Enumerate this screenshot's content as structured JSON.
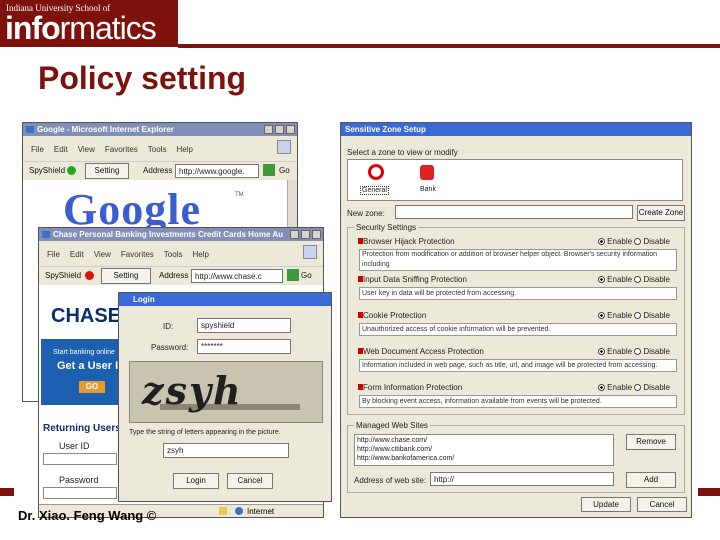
{
  "header": {
    "logo_line1": "Indiana University School of",
    "logo_info": "info",
    "logo_rest": "rmatics"
  },
  "slide": {
    "title": "Policy setting",
    "footer": "Dr. Xiao. Feng Wang ©"
  },
  "ie_google": {
    "title": "Google - Microsoft Internet Explorer",
    "menu": [
      "File",
      "Edit",
      "View",
      "Favorites",
      "Tools",
      "Help"
    ],
    "spyshield_label": "SpyShield",
    "setting_button": "Setting",
    "address_label": "Address",
    "address_value": "http://www.google.",
    "go_label": "Go",
    "logo_text": "Google",
    "tm": "TM",
    "indicator_color": "#22aa22"
  },
  "ie_chase": {
    "title": "Chase Personal Banking Investments Credit Cards Home Au",
    "menu": [
      "File",
      "Edit",
      "View",
      "Favorites",
      "Tools",
      "Help"
    ],
    "spyshield_label": "SpyShield",
    "setting_button": "Setting",
    "address_label": "Address",
    "address_value": "http://www.chase.c",
    "go_label": "Go",
    "chase_logo": "CHASE",
    "banner_line1": "Start banking online",
    "banner_line2": "Get a User ID",
    "banner_go": "GO",
    "returning_users": "Returning Users: Log",
    "user_id_label": "User ID",
    "password_label": "Password",
    "status_internet": "Internet",
    "indicator_color": "#dd1111"
  },
  "login": {
    "title": "Login",
    "id_label": "ID:",
    "id_value": "spyshield",
    "password_label": "Password:",
    "password_value": "*******",
    "captcha_text": "zsyh",
    "instruction": "Type the string of letters appearing in the picture.",
    "captcha_input": "zsyh",
    "login_button": "Login",
    "cancel_button": "Cancel"
  },
  "zone_setup": {
    "title": "Sensitive Zone Setup",
    "select_label": "Select a zone to view or modify",
    "zones": [
      {
        "label": "General",
        "icon": "no-entry-icon"
      },
      {
        "label": "Bank",
        "icon": "money-icon"
      }
    ],
    "new_zone_label": "New zone:",
    "create_zone_button": "Create Zone",
    "security_settings_label": "Security Settings",
    "settings": [
      {
        "label": "Browser Hijack Protection",
        "desc": "Protection from modification or addition of browser helper object. Browser's security information including",
        "enable": "Enable",
        "disable": "Disable"
      },
      {
        "label": "Input Data Sniffing Protection",
        "desc": "User key in data will be protected from accessing.",
        "enable": "Enable",
        "disable": "Disable"
      },
      {
        "label": "Cookie Protection",
        "desc": "Unauthorized access of cookie information will be prevented.",
        "enable": "Enable",
        "disable": "Disable"
      },
      {
        "label": "Web Document Access Protection",
        "desc": "Information included in web page, such as title, url, and image will be protected from accessing.",
        "enable": "Enable",
        "disable": "Disable"
      },
      {
        "label": "Form Information Protection",
        "desc": "By blocking event access, information available from events will be protected.",
        "enable": "Enable",
        "disable": "Disable"
      }
    ],
    "managed_sites_label": "Managed Web Sites",
    "sites": [
      "http://www.chase.com/",
      "http://www.citibank.com/",
      "http://www.bankofamerica.com/"
    ],
    "remove_button": "Remove",
    "address_label": "Address of web site:",
    "address_value": "http://",
    "add_button": "Add",
    "update_button": "Update",
    "cancel_button": "Cancel"
  }
}
